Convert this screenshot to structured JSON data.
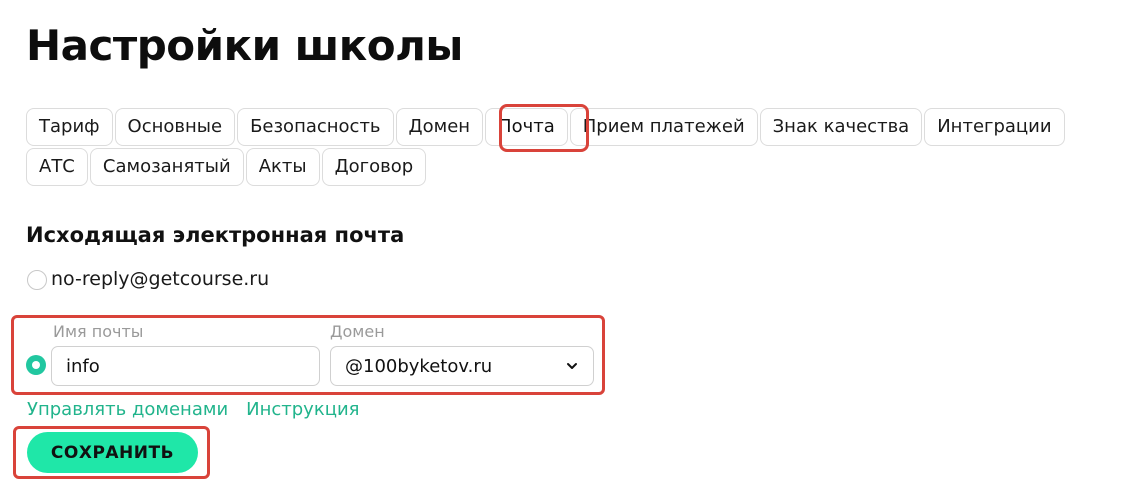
{
  "page": {
    "title": "Настройки школы"
  },
  "tabs": {
    "row1": [
      "Тариф",
      "Основные",
      "Безопасность",
      "Домен",
      "Почта",
      "Прием платежей",
      "Знак качества",
      "Интеграции"
    ],
    "row2": [
      "АТС",
      "Самозанятый",
      "Акты",
      "Договор"
    ],
    "active": "Почта"
  },
  "outgoing_email": {
    "section_title": "Исходящая электронная почта",
    "default_option": "no-reply@getcourse.ru",
    "custom": {
      "name_caption": "Имя почты",
      "name_value": "info",
      "domain_caption": "Домен",
      "domain_value": "@100byketov.ru",
      "selected": true
    },
    "links": {
      "manage_domains": "Управлять доменами",
      "instructions": "Инструкция"
    }
  },
  "actions": {
    "save_label": "СОХРАНИТЬ"
  },
  "colors": {
    "accent": "#1fe7a8",
    "link": "#21b48c",
    "radio_selected": "#21c7a0",
    "highlight": "#d9433a"
  },
  "icons": {
    "domain_select": "chevron-down-icon"
  }
}
